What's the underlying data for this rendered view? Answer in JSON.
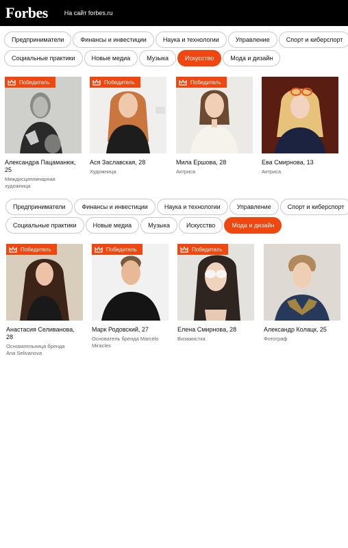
{
  "header": {
    "logo": "Forbes",
    "site_link": "На сайт forbes.ru"
  },
  "sections": [
    {
      "tabs_row1": [
        "Предприниматели",
        "Финансы и инвестиции",
        "Наука и технологии",
        "Управление",
        "Спорт и киберспорт"
      ],
      "tabs_row2": [
        "Социальные практики",
        "Новые медиа",
        "Музыка",
        "Искусство",
        "Мода и дизайн"
      ],
      "active_tab": "Искусство",
      "cards": [
        {
          "badge": "Победитель",
          "name": "Александра Пацаманюк, 25",
          "role": "Междисциплинарная художница"
        },
        {
          "badge": "Победитель",
          "name": "Ася Заславская, 28",
          "role": "Художница"
        },
        {
          "badge": "Победитель",
          "name": "Мила Ершова, 28",
          "role": "Актриса"
        },
        {
          "badge": "",
          "name": "Ева Смирнова, 13",
          "role": "Актриса"
        }
      ]
    },
    {
      "tabs_row1": [
        "Предприниматели",
        "Финансы и инвестиции",
        "Наука и технологии",
        "Управление",
        "Спорт и киберспорт"
      ],
      "tabs_row2": [
        "Социальные практики",
        "Новые медиа",
        "Музыка",
        "Искусство",
        "Мода и дизайн"
      ],
      "active_tab": "Мода и дизайн",
      "cards": [
        {
          "badge": "Победитель",
          "name": "Анастасия Селиванова, 28",
          "role": "Основательница бренда Ana Selivanova"
        },
        {
          "badge": "Победитель",
          "name": "Марк Родовский, 27",
          "role": "Основатель бренда Marcelo Miracles"
        },
        {
          "badge": "Победитель",
          "name": "Елена Смирнова, 28",
          "role": "Визажистка"
        },
        {
          "badge": "",
          "name": "Александр Колацк, 25",
          "role": "Фотограф"
        }
      ]
    }
  ],
  "colors": {
    "accent": "#f0460f",
    "header_bg": "#000000"
  }
}
